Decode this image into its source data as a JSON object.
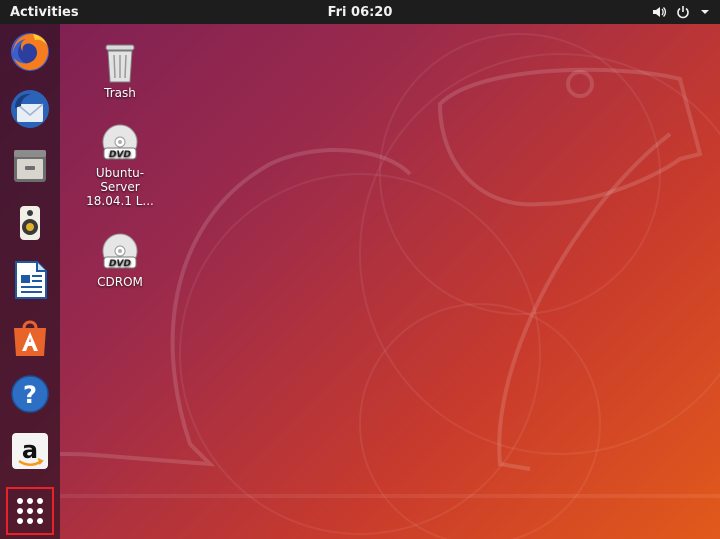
{
  "topbar": {
    "activities_label": "Activities",
    "clock": "Fri 06:20",
    "tray_icons": [
      "volume-icon",
      "power-icon",
      "chevron-down-icon"
    ]
  },
  "dock": {
    "items": [
      {
        "name": "Firefox",
        "icon": "firefox-icon"
      },
      {
        "name": "Thunderbird",
        "icon": "thunderbird-icon"
      },
      {
        "name": "Files",
        "icon": "files-icon"
      },
      {
        "name": "Rhythmbox",
        "icon": "rhythmbox-icon"
      },
      {
        "name": "LibreOffice Writer",
        "icon": "writer-icon"
      },
      {
        "name": "Ubuntu Software",
        "icon": "software-icon"
      },
      {
        "name": "Help",
        "icon": "help-icon"
      },
      {
        "name": "Amazon",
        "icon": "amazon-icon"
      },
      {
        "name": "Show Applications",
        "icon": "apps-grid-icon"
      }
    ]
  },
  "desktop": {
    "icons": [
      {
        "label": "Trash",
        "icon": "trash-icon"
      },
      {
        "label_line1": "Ubuntu-",
        "label_line2": "Server",
        "label_line3": "18.04.1 L...",
        "icon": "dvd-icon"
      },
      {
        "label": "CDROM",
        "icon": "dvd-icon"
      }
    ]
  },
  "colors": {
    "topbar": "#1d1d1d",
    "highlight": "#ea2227",
    "wallpaper_start": "#7a1f55",
    "wallpaper_end": "#e25a1b"
  }
}
